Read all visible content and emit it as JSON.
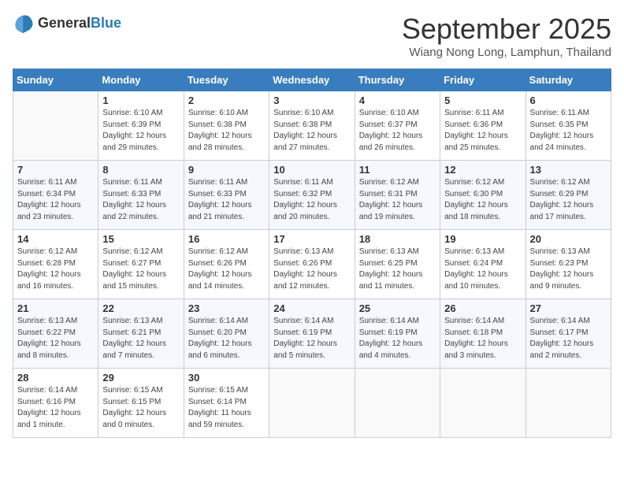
{
  "header": {
    "logo_general": "General",
    "logo_blue": "Blue",
    "month": "September 2025",
    "location": "Wiang Nong Long, Lamphun, Thailand"
  },
  "days_of_week": [
    "Sunday",
    "Monday",
    "Tuesday",
    "Wednesday",
    "Thursday",
    "Friday",
    "Saturday"
  ],
  "weeks": [
    [
      {
        "day": "",
        "info": ""
      },
      {
        "day": "1",
        "info": "Sunrise: 6:10 AM\nSunset: 6:39 PM\nDaylight: 12 hours\nand 29 minutes."
      },
      {
        "day": "2",
        "info": "Sunrise: 6:10 AM\nSunset: 6:38 PM\nDaylight: 12 hours\nand 28 minutes."
      },
      {
        "day": "3",
        "info": "Sunrise: 6:10 AM\nSunset: 6:38 PM\nDaylight: 12 hours\nand 27 minutes."
      },
      {
        "day": "4",
        "info": "Sunrise: 6:10 AM\nSunset: 6:37 PM\nDaylight: 12 hours\nand 26 minutes."
      },
      {
        "day": "5",
        "info": "Sunrise: 6:11 AM\nSunset: 6:36 PM\nDaylight: 12 hours\nand 25 minutes."
      },
      {
        "day": "6",
        "info": "Sunrise: 6:11 AM\nSunset: 6:35 PM\nDaylight: 12 hours\nand 24 minutes."
      }
    ],
    [
      {
        "day": "7",
        "info": "Sunrise: 6:11 AM\nSunset: 6:34 PM\nDaylight: 12 hours\nand 23 minutes."
      },
      {
        "day": "8",
        "info": "Sunrise: 6:11 AM\nSunset: 6:33 PM\nDaylight: 12 hours\nand 22 minutes."
      },
      {
        "day": "9",
        "info": "Sunrise: 6:11 AM\nSunset: 6:33 PM\nDaylight: 12 hours\nand 21 minutes."
      },
      {
        "day": "10",
        "info": "Sunrise: 6:11 AM\nSunset: 6:32 PM\nDaylight: 12 hours\nand 20 minutes."
      },
      {
        "day": "11",
        "info": "Sunrise: 6:12 AM\nSunset: 6:31 PM\nDaylight: 12 hours\nand 19 minutes."
      },
      {
        "day": "12",
        "info": "Sunrise: 6:12 AM\nSunset: 6:30 PM\nDaylight: 12 hours\nand 18 minutes."
      },
      {
        "day": "13",
        "info": "Sunrise: 6:12 AM\nSunset: 6:29 PM\nDaylight: 12 hours\nand 17 minutes."
      }
    ],
    [
      {
        "day": "14",
        "info": "Sunrise: 6:12 AM\nSunset: 6:28 PM\nDaylight: 12 hours\nand 16 minutes."
      },
      {
        "day": "15",
        "info": "Sunrise: 6:12 AM\nSunset: 6:27 PM\nDaylight: 12 hours\nand 15 minutes."
      },
      {
        "day": "16",
        "info": "Sunrise: 6:12 AM\nSunset: 6:26 PM\nDaylight: 12 hours\nand 14 minutes."
      },
      {
        "day": "17",
        "info": "Sunrise: 6:13 AM\nSunset: 6:26 PM\nDaylight: 12 hours\nand 12 minutes."
      },
      {
        "day": "18",
        "info": "Sunrise: 6:13 AM\nSunset: 6:25 PM\nDaylight: 12 hours\nand 11 minutes."
      },
      {
        "day": "19",
        "info": "Sunrise: 6:13 AM\nSunset: 6:24 PM\nDaylight: 12 hours\nand 10 minutes."
      },
      {
        "day": "20",
        "info": "Sunrise: 6:13 AM\nSunset: 6:23 PM\nDaylight: 12 hours\nand 9 minutes."
      }
    ],
    [
      {
        "day": "21",
        "info": "Sunrise: 6:13 AM\nSunset: 6:22 PM\nDaylight: 12 hours\nand 8 minutes."
      },
      {
        "day": "22",
        "info": "Sunrise: 6:13 AM\nSunset: 6:21 PM\nDaylight: 12 hours\nand 7 minutes."
      },
      {
        "day": "23",
        "info": "Sunrise: 6:14 AM\nSunset: 6:20 PM\nDaylight: 12 hours\nand 6 minutes."
      },
      {
        "day": "24",
        "info": "Sunrise: 6:14 AM\nSunset: 6:19 PM\nDaylight: 12 hours\nand 5 minutes."
      },
      {
        "day": "25",
        "info": "Sunrise: 6:14 AM\nSunset: 6:19 PM\nDaylight: 12 hours\nand 4 minutes."
      },
      {
        "day": "26",
        "info": "Sunrise: 6:14 AM\nSunset: 6:18 PM\nDaylight: 12 hours\nand 3 minutes."
      },
      {
        "day": "27",
        "info": "Sunrise: 6:14 AM\nSunset: 6:17 PM\nDaylight: 12 hours\nand 2 minutes."
      }
    ],
    [
      {
        "day": "28",
        "info": "Sunrise: 6:14 AM\nSunset: 6:16 PM\nDaylight: 12 hours\nand 1 minute."
      },
      {
        "day": "29",
        "info": "Sunrise: 6:15 AM\nSunset: 6:15 PM\nDaylight: 12 hours\nand 0 minutes."
      },
      {
        "day": "30",
        "info": "Sunrise: 6:15 AM\nSunset: 6:14 PM\nDaylight: 11 hours\nand 59 minutes."
      },
      {
        "day": "",
        "info": ""
      },
      {
        "day": "",
        "info": ""
      },
      {
        "day": "",
        "info": ""
      },
      {
        "day": "",
        "info": ""
      }
    ]
  ]
}
